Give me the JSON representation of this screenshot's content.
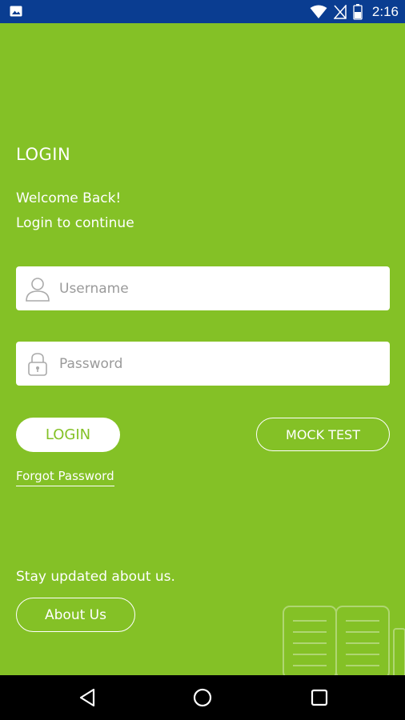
{
  "status_bar": {
    "time": "2:16",
    "icons": [
      "image-icon",
      "wifi-icon",
      "signal-icon",
      "battery-icon"
    ],
    "background": "#0a3d91"
  },
  "login": {
    "title": "LOGIN",
    "welcome": "Welcome Back!",
    "prompt": "Login to continue",
    "username_placeholder": "Username",
    "password_placeholder": "Password",
    "username_value": "",
    "password_value": "",
    "login_button": "LOGIN",
    "mock_test_button": "MOCK TEST",
    "forgot_password": "Forgot Password"
  },
  "footer": {
    "stay_updated": "Stay updated about us.",
    "about_button": "About Us"
  },
  "nav_bar": {
    "buttons": [
      "back-icon",
      "home-icon",
      "recents-icon"
    ]
  },
  "colors": {
    "accent": "#84c126",
    "status_bar": "#0a3d91",
    "text_on_accent": "#ffffff"
  }
}
